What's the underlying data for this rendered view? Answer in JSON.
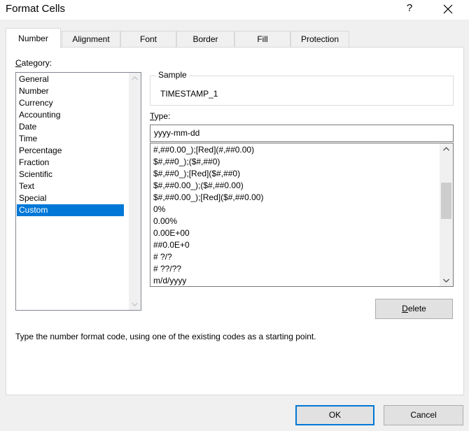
{
  "dialog": {
    "title": "Format Cells",
    "help": "?"
  },
  "tabs": [
    {
      "label": "Number",
      "active": true
    },
    {
      "label": "Alignment",
      "active": false
    },
    {
      "label": "Font",
      "active": false
    },
    {
      "label": "Border",
      "active": false
    },
    {
      "label": "Fill",
      "active": false
    },
    {
      "label": "Protection",
      "active": false
    }
  ],
  "category": {
    "label_key": "C",
    "label_rest": "ategory:",
    "items": [
      "General",
      "Number",
      "Currency",
      "Accounting",
      "Date",
      "Time",
      "Percentage",
      "Fraction",
      "Scientific",
      "Text",
      "Special",
      "Custom"
    ],
    "selected": "Custom"
  },
  "sample": {
    "legend": "Sample",
    "value": "TIMESTAMP_1"
  },
  "type": {
    "label_key": "T",
    "label_rest": "ype:",
    "value": "yyyy-mm-dd"
  },
  "formats": [
    "#,##0.00_);[Red](#,##0.00)",
    "$#,##0_);($#,##0)",
    "$#,##0_);[Red]($#,##0)",
    "$#,##0.00_);($#,##0.00)",
    "$#,##0.00_);[Red]($#,##0.00)",
    "0%",
    "0.00%",
    "0.00E+00",
    "##0.0E+0",
    "# ?/?",
    "# ??/??",
    "m/d/yyyy"
  ],
  "buttons": {
    "delete_key": "D",
    "delete_rest": "elete",
    "ok": "OK",
    "cancel": "Cancel"
  },
  "help_text": "Type the number format code, using one of the existing codes as a starting point.",
  "colors": {
    "selection": "#0078d7",
    "panel_bg": "#ffffff",
    "dialog_bg": "#f0f0f0"
  }
}
